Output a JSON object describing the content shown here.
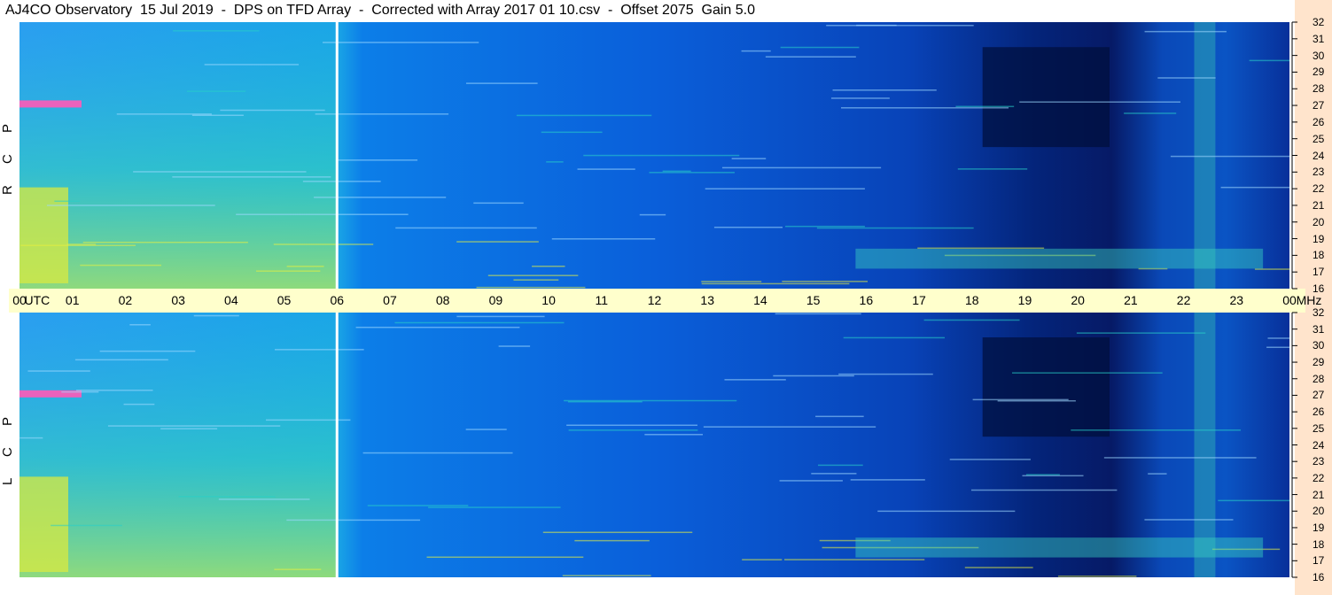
{
  "title": "AJ4CO Observatory  15 Jul 2019  -  DPS on TFD Array  -  Corrected with Array 2017 01 10.csv  -  Offset 2075  Gain 5.0",
  "chart_data": {
    "type": "heatmap",
    "title": "AJ4CO Observatory  15 Jul 2019  -  DPS on TFD Array  -  Corrected with Array 2017 01 10.csv  -  Offset 2075  Gain 5.0",
    "x_ticks": [
      "00",
      "01",
      "02",
      "03",
      "04",
      "05",
      "06",
      "07",
      "08",
      "09",
      "10",
      "11",
      "12",
      "13",
      "14",
      "15",
      "16",
      "17",
      "18",
      "19",
      "20",
      "21",
      "22",
      "23",
      "00"
    ],
    "x_unit_label": "UTC",
    "x_range_hours": [
      0,
      24
    ],
    "y_ticks": [
      "16",
      "17",
      "18",
      "19",
      "20",
      "21",
      "22",
      "23",
      "24",
      "25",
      "26",
      "27",
      "28",
      "29",
      "30",
      "31",
      "32"
    ],
    "y_unit_label": "MHz",
    "y_range_mhz": [
      16,
      32
    ],
    "panels": [
      {
        "label": "R C P"
      },
      {
        "label": "L C P"
      }
    ],
    "marker_time_hour": 6,
    "colors": {
      "low": "#001a66",
      "mid": "#0a64e6",
      "high": "#28d0c8",
      "hot": "#e8f040",
      "peak": "#ff3ab0",
      "axis_bg": "#ffffcc",
      "right_bg": "#ffe4cc"
    }
  }
}
